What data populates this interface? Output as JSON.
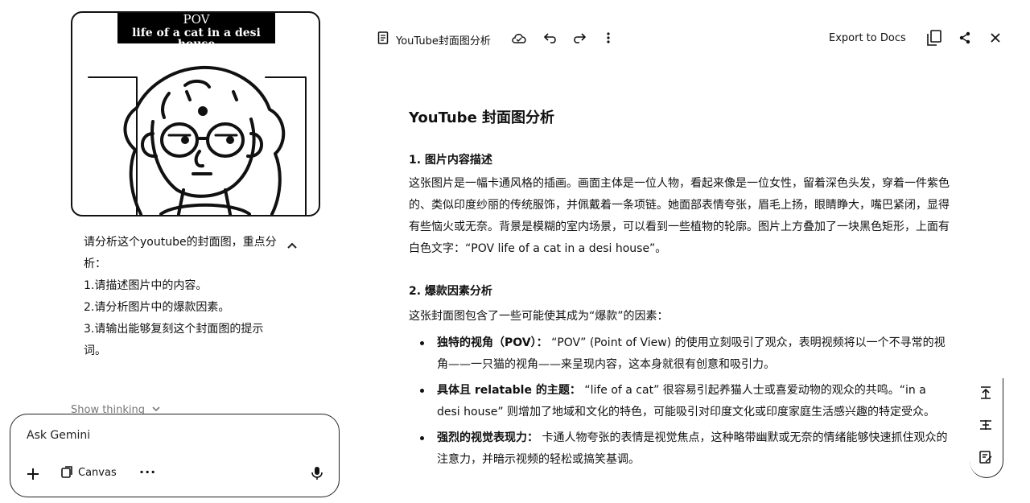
{
  "chat": {
    "thumbnail": {
      "overlay_line1": "POV",
      "overlay_line2": "life of a cat in a desi house"
    },
    "user_message": "请分析这个youtube的封面图，重点分析：\n1.请描述图片中的内容。\n2.请分析图片中的爆款因素。\n3.请输出能够复刻这个封面图的提示词。",
    "thinking_label": "Show thinking",
    "input": {
      "placeholder": "Ask Gemini",
      "canvas_label": "Canvas",
      "more_label": "···"
    }
  },
  "toolbar": {
    "doc_title": "YouTube封面图分析",
    "export_label": "Export to Docs"
  },
  "doc": {
    "title": "YouTube 封面图分析",
    "sec1_heading": "1. 图片内容描述",
    "sec1_body": "这张图片是一幅卡通风格的插画。画面主体是一位人物，看起来像是一位女性，留着深色头发，穿着一件紫色的、类似印度纱丽的传统服饰，并佩戴着一条项链。她面部表情夸张，眉毛上扬，眼睛睁大，嘴巴紧闭，显得有些恼火或无奈。背景是模糊的室内场景，可以看到一些植物的轮廓。图片上方叠加了一块黑色矩形，上面有白色文字：“POV life of a cat in a desi house”。",
    "sec2_heading": "2. 爆款因素分析",
    "sec2_intro": "这张封面图包含了一些可能使其成为“爆款”的因素：",
    "bullets": [
      {
        "bold": "独特的视角（POV）：",
        "text": "“POV” (Point of View) 的使用立刻吸引了观众，表明视频将以一个不寻常的视角——一只猫的视角——来呈现内容，这本身就很有创意和吸引力。"
      },
      {
        "bold": "具体且 relatable 的主题：",
        "text": "“life of a cat” 很容易引起养猫人士或喜爱动物的观众的共鸣。“in a desi house” 则增加了地域和文化的特色，可能吸引对印度文化或印度家庭生活感兴趣的特定受众。"
      },
      {
        "bold": "强烈的视觉表现力：",
        "text": "卡通人物夸张的表情是视觉焦点，这种略带幽默或无奈的情绪能够快速抓住观众的注意力，并暗示视频的轻松或搞笑基调。"
      }
    ]
  },
  "icons": [
    "doc-icon",
    "cloud-icon",
    "undo-icon",
    "redo-icon",
    "more-vert-icon",
    "copy-icon",
    "share-icon",
    "close-icon",
    "chevron-up-icon",
    "chevron-down-icon",
    "plus-icon",
    "canvas-icon",
    "mic-icon",
    "scroll-top-icon",
    "format-icon",
    "edit-note-icon"
  ]
}
